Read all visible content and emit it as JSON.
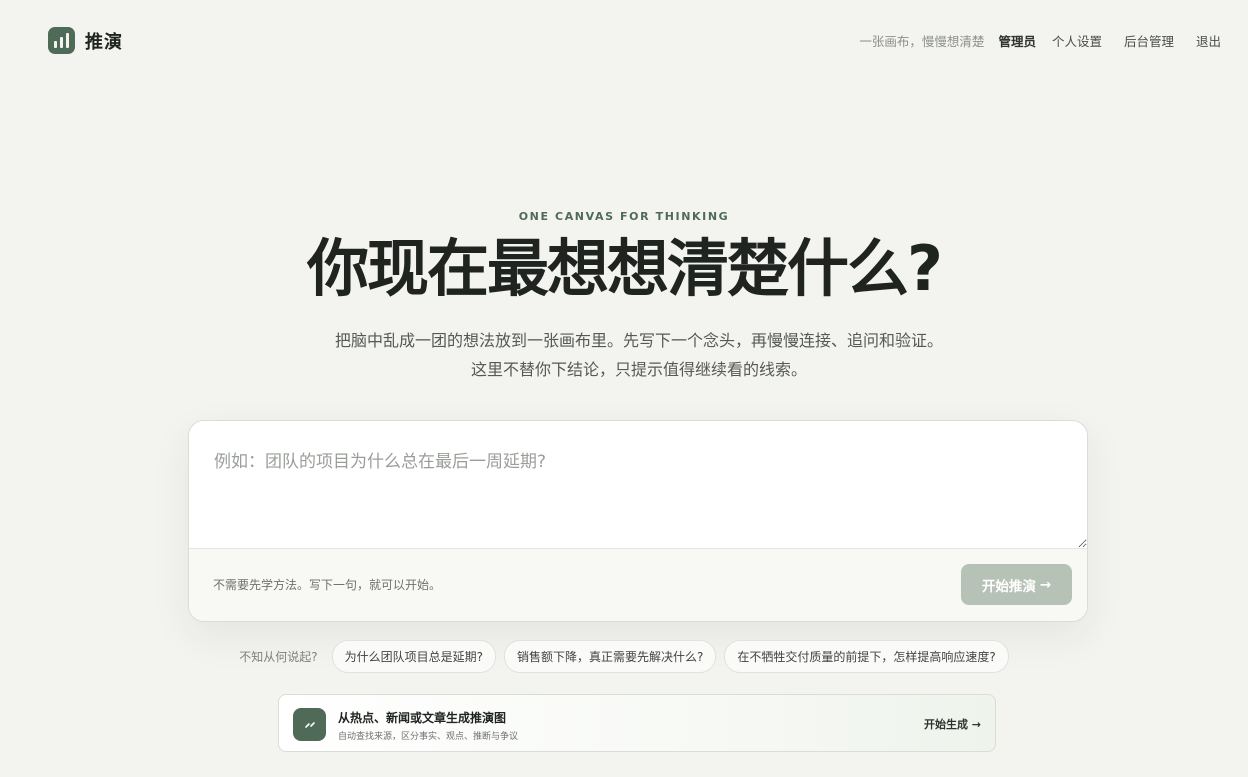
{
  "header": {
    "brand": "推演",
    "tagline": "一张画布，慢慢想清楚",
    "username": "管理员",
    "nav": {
      "settings": "个人设置",
      "admin": "后台管理",
      "logout": "退出"
    }
  },
  "hero": {
    "eyebrow": "ONE CANVAS FOR THINKING",
    "title": "你现在最想想清楚什么?",
    "description": "把脑中乱成一团的想法放到一张画布里。先写下一个念头，再慢慢连接、追问和验证。这里不替你下结论，只提示值得继续看的线索。"
  },
  "input_card": {
    "value": "",
    "placeholder": "例如：团队的项目为什么总在最后一周延期?",
    "hint": "不需要先学方法。写下一句，就可以开始。",
    "start_button": "开始推演",
    "start_button_arrow": "→"
  },
  "suggestions": {
    "label": "不知从何说起?",
    "items": [
      "为什么团队项目总是延期?",
      "销售额下降，真正需要先解决什么?",
      "在不牺牲交付质量的前提下，怎样提高响应速度?"
    ]
  },
  "generate_card": {
    "icon": "link-icon",
    "title": "从热点、新闻或文章生成推演图",
    "subtitle": "自动查找来源，区分事实、观点、推断与争议",
    "action": "开始生成 →"
  },
  "colors": {
    "accent": "#4f6b58",
    "background": "#f3f3f0",
    "button_disabled": "#b7c2b7"
  }
}
